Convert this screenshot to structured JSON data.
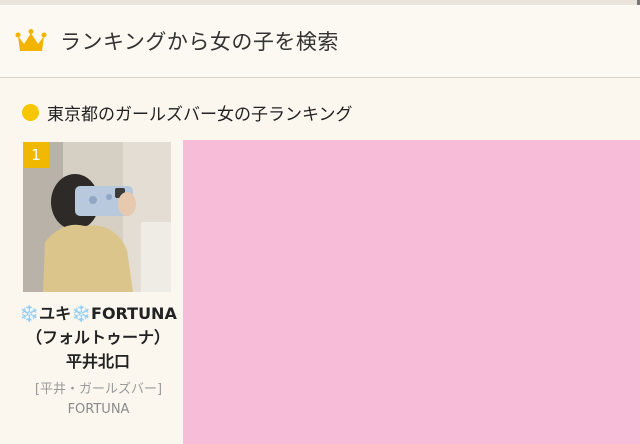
{
  "header": {
    "title": "ランキングから女の子を検索",
    "icon": "crown-icon"
  },
  "section": {
    "title": "東京都のガールズバー女の子ランキング"
  },
  "ranking": [
    {
      "rank": "1",
      "name_flake": "❄️",
      "name_part1": "ユキ",
      "name_part2": "FORTUNA（フォルトゥーナ）平井北口",
      "area": "[平井・ガールズバー]",
      "shop": "FORTUNA"
    }
  ],
  "colors": {
    "accent": "#f6c600",
    "badge": "#f1b800",
    "panel": "#f7bcd8",
    "background": "#fbf7ef"
  }
}
